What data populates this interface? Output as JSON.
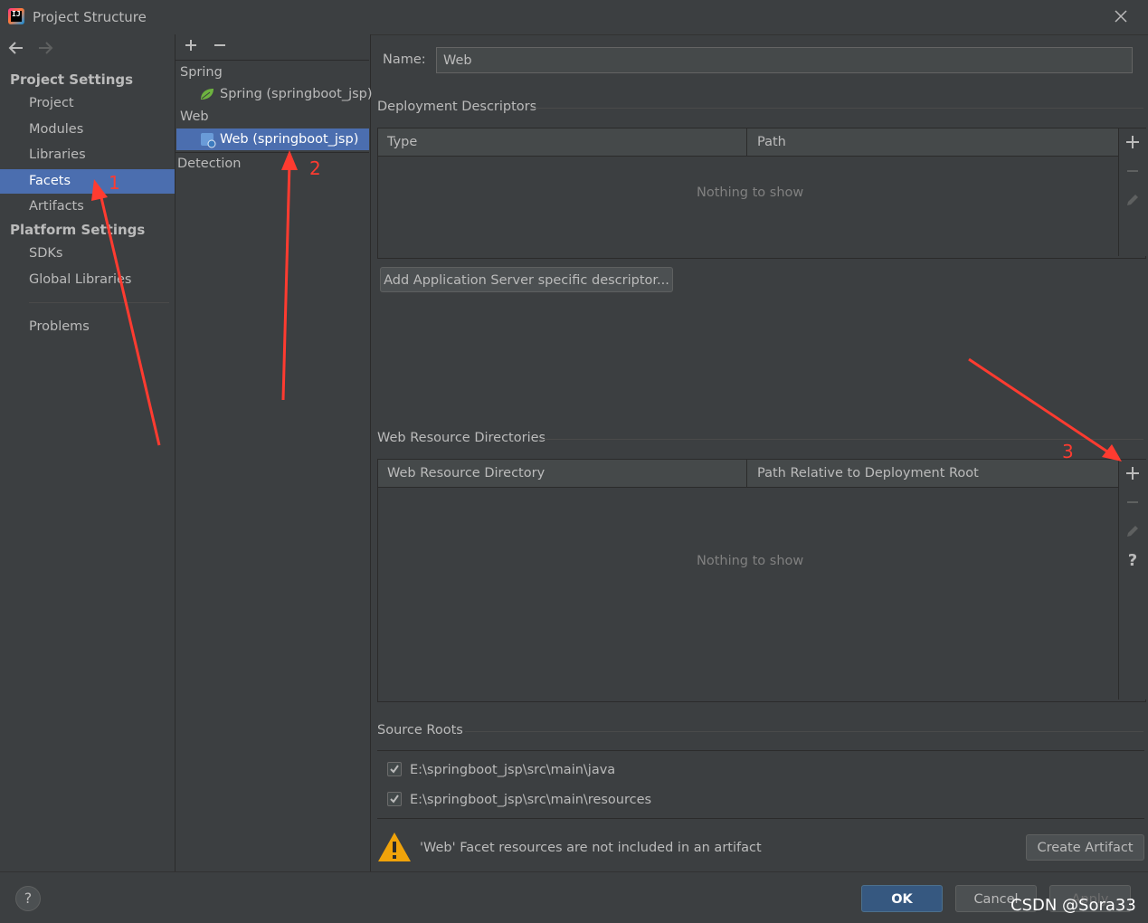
{
  "window": {
    "title": "Project Structure"
  },
  "nav": {
    "project_settings_header": "Project Settings",
    "items": [
      "Project",
      "Modules",
      "Libraries",
      "Facets",
      "Artifacts"
    ],
    "platform_settings_header": "Platform Settings",
    "platform_items": [
      "SDKs",
      "Global Libraries"
    ],
    "problems": "Problems",
    "selected": "Facets"
  },
  "tree": {
    "groups": [
      {
        "label": "Spring",
        "children": [
          "Spring (springboot_jsp)"
        ]
      },
      {
        "label": "Web",
        "children": [
          "Web (springboot_jsp)"
        ]
      }
    ],
    "detection": "Detection",
    "selected": "Web (springboot_jsp)"
  },
  "facet": {
    "name_label": "Name:",
    "name_value": "Web",
    "deployment_descriptors_title": "Deployment Descriptors",
    "dd_columns": [
      "Type",
      "Path"
    ],
    "dd_empty": "Nothing to show",
    "add_server_descriptor_button": "Add Application Server specific descriptor...",
    "web_resource_title": "Web Resource Directories",
    "wr_columns": [
      "Web Resource Directory",
      "Path Relative to Deployment Root"
    ],
    "wr_empty": "Nothing to show",
    "source_roots_title": "Source Roots",
    "source_roots": [
      {
        "path": "E:\\springboot_jsp\\src\\main\\java",
        "checked": true
      },
      {
        "path": "E:\\springboot_jsp\\src\\main\\resources",
        "checked": true
      }
    ],
    "warning_text": "'Web' Facet resources are not included in an artifact",
    "create_artifact_button": "Create Artifact"
  },
  "footer": {
    "ok": "OK",
    "cancel": "Cancel",
    "apply": "Apply",
    "help": "?"
  },
  "annotations": {
    "a1": "1",
    "a2": "2",
    "a3": "3",
    "watermark": "CSDN @Sora33"
  },
  "colors": {
    "selection": "#4b6eaf",
    "background": "#3c3f41",
    "arrow": "#ff3b30",
    "warning": "#f0a30a",
    "spring_leaf": "#6db33f"
  }
}
